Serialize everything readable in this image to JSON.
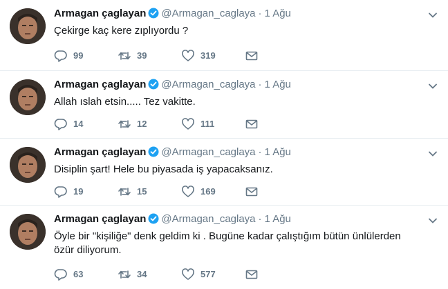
{
  "accent_color": "#1da1f2",
  "icons": {
    "verified": "verified-badge-icon",
    "caret": "chevron-down-icon",
    "reply": "reply-icon",
    "retweet": "retweet-icon",
    "like": "heart-icon",
    "dm": "envelope-icon"
  },
  "tweets": [
    {
      "name": "Armagan çaglayan",
      "handle": "@Armagan_caglaya",
      "dot": "·",
      "time": "1 Ağu",
      "text": "Çekirge kaç kere zıplıyordu ?",
      "replies": "99",
      "retweets": "39",
      "likes": "319"
    },
    {
      "name": "Armagan çaglayan",
      "handle": "@Armagan_caglaya",
      "dot": "·",
      "time": "1 Ağu",
      "text": "Allah ıslah etsin..... Tez vakitte.",
      "replies": "14",
      "retweets": "12",
      "likes": "111"
    },
    {
      "name": "Armagan çaglayan",
      "handle": "@Armagan_caglaya",
      "dot": "·",
      "time": "1 Ağu",
      "text": "Disiplin şart! Hele bu piyasada iş yapacaksanız.",
      "replies": "19",
      "retweets": "15",
      "likes": "169"
    },
    {
      "name": "Armagan çaglayan",
      "handle": "@Armagan_caglaya",
      "dot": "·",
      "time": "1 Ağu",
      "text": "Öyle bir \"kişiliğe\" denk geldim ki . Bugüne kadar çalıştığım bütün ünlülerden özür diliyorum.",
      "replies": "63",
      "retweets": "34",
      "likes": "577"
    }
  ]
}
